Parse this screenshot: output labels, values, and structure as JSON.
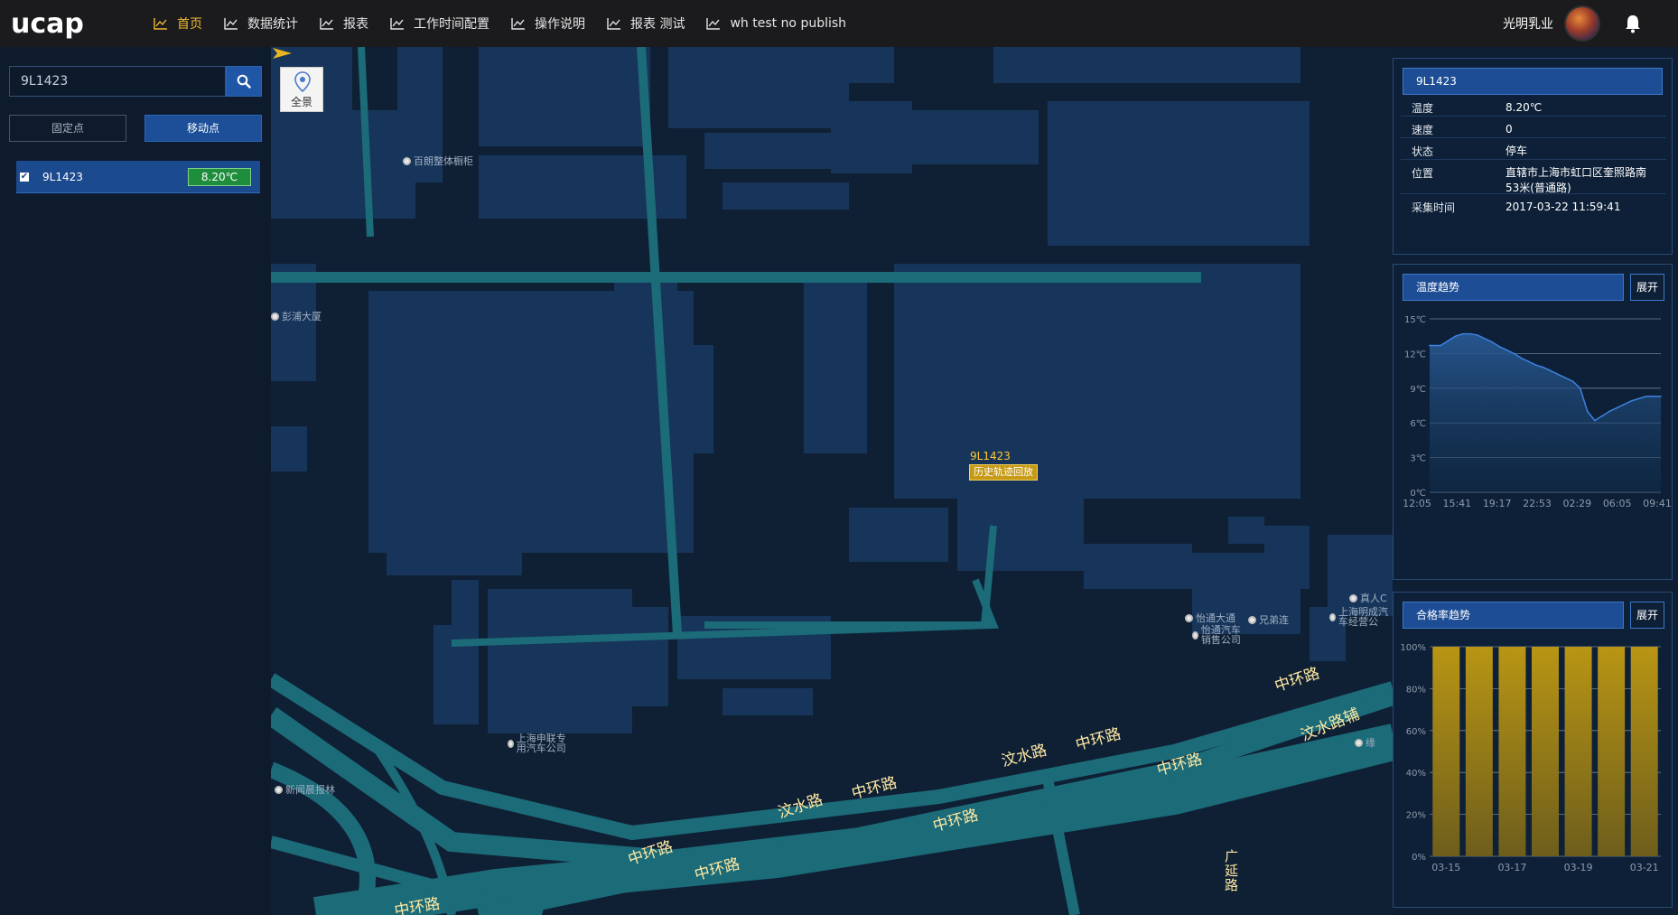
{
  "app": {
    "logo_text": "ucap",
    "nav": [
      {
        "label": "首页",
        "active": true
      },
      {
        "label": "数据统计",
        "active": false
      },
      {
        "label": "报表",
        "active": false
      },
      {
        "label": "工作时间配置",
        "active": false
      },
      {
        "label": "操作说明",
        "active": false
      },
      {
        "label": "报表 测试",
        "active": false
      },
      {
        "label": "wh test no publish",
        "active": false
      }
    ],
    "company": "光明乳业",
    "icons": {
      "nav": "line-chart-icon",
      "bell": "bell-icon",
      "search": "search-icon"
    }
  },
  "left": {
    "search_value": "9L1423",
    "tab_fixed": "固定点",
    "tab_moving": "移动点",
    "vehicles": [
      {
        "plate": "9L1423",
        "temp": "8.20℃",
        "checked": true
      }
    ]
  },
  "map": {
    "panorama_label": "全景",
    "pois": [
      "百朗整体橱柜",
      "彭浦大厦",
      "怡通大通",
      "怡通汽车销售公司",
      "兄弟连",
      "真人C",
      "上海明成汽车经营公",
      "上海申联专用汽车公司",
      "新闻晨报林",
      "缘"
    ],
    "roads": [
      "中环路",
      "汶水路",
      "中环路",
      "中环路",
      "汶水路",
      "中环路",
      "中环路",
      "中环路",
      "中环路",
      "汶水路辅",
      "中环路",
      "广延路"
    ],
    "marker": {
      "plate": "9L1423",
      "replay_label": "历史轨迹回放"
    }
  },
  "info_panel": {
    "title": "9L1423",
    "rows": [
      {
        "key": "温度",
        "value": "8.20℃"
      },
      {
        "key": "速度",
        "value": "0"
      },
      {
        "key": "状态",
        "value": "停车"
      },
      {
        "key": "位置",
        "value": "直辖市上海市虹口区奎照路南53米(普通路)"
      },
      {
        "key": "采集时间",
        "value": "2017-03-22 11:59:41"
      }
    ]
  },
  "temp_panel": {
    "title": "温度趋势",
    "expand": "展开"
  },
  "rate_panel": {
    "title": "合格率趋势",
    "expand": "展开"
  },
  "chart_data": [
    {
      "type": "area",
      "title": "温度趋势",
      "x_ticks": [
        "12:05",
        "15:41",
        "19:17",
        "22:53",
        "02:29",
        "06:05",
        "09:41"
      ],
      "y_ticks": [
        "0℃",
        "3℃",
        "6℃",
        "9℃",
        "12℃",
        "15℃"
      ],
      "ylim": [
        0,
        15
      ],
      "series": [
        {
          "x": [
            0,
            3,
            5,
            7,
            9,
            11,
            13,
            15,
            17,
            19,
            21,
            23,
            25,
            27,
            29,
            31,
            33,
            35,
            37,
            39,
            41,
            42,
            43,
            44,
            45,
            47,
            49,
            51,
            53,
            55,
            57,
            59,
            61,
            63
          ],
          "y": [
            12.7,
            12.7,
            13.1,
            13.5,
            13.7,
            13.7,
            13.6,
            13.3,
            13.0,
            12.6,
            12.3,
            12.0,
            11.6,
            11.3,
            11.0,
            10.8,
            10.5,
            10.2,
            9.9,
            9.6,
            9.0,
            8.0,
            7.0,
            6.6,
            6.2,
            6.6,
            7.0,
            7.3,
            7.6,
            7.9,
            8.1,
            8.3,
            8.3,
            8.3
          ]
        }
      ],
      "grid": true
    },
    {
      "type": "bar",
      "title": "合格率趋势",
      "categories": [
        "03-15",
        "03-16",
        "03-17",
        "03-18",
        "03-19",
        "03-20",
        "03-21"
      ],
      "x_tick_labels": [
        "03-15",
        "03-17",
        "03-19",
        "03-21"
      ],
      "values": [
        100,
        100,
        100,
        100,
        100,
        100,
        100
      ],
      "y_ticks": [
        "0%",
        "20%",
        "40%",
        "60%",
        "80%",
        "100%"
      ],
      "ylim": [
        0,
        100
      ],
      "bar_color": "#b08c14",
      "grid": true
    }
  ]
}
